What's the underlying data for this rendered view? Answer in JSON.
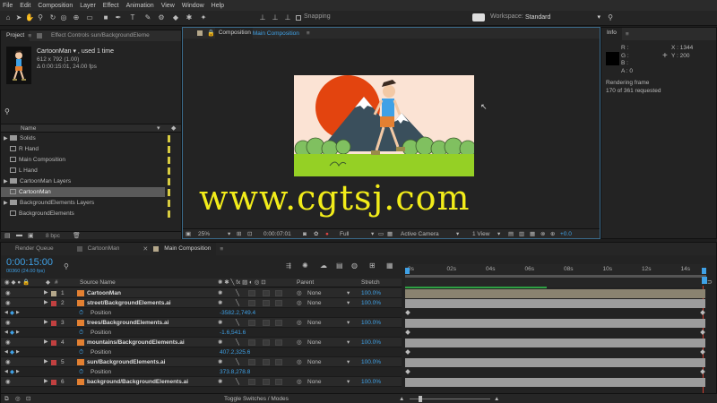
{
  "menu": [
    "File",
    "Edit",
    "Composition",
    "Layer",
    "Effect",
    "Animation",
    "View",
    "Window",
    "Help"
  ],
  "toolbar": {
    "snapping_label": "Snapping",
    "workspace_label": "Workspace:",
    "workspace_value": "Standard"
  },
  "project_panel": {
    "tab_project": "Project",
    "tab_effect_controls": "Effect Controls sun/BackgroundEleme",
    "selected_name": "CartoonMan ▾ , used 1 time",
    "selected_dims": "612 x 792 (1.00)",
    "selected_duration": "Δ 0:00:15:01, 24.00 fps",
    "column_name": "Name",
    "items": [
      {
        "label": "Solids",
        "kind": "folder"
      },
      {
        "label": "R Hand",
        "kind": "comp"
      },
      {
        "label": "Main Composition",
        "kind": "comp"
      },
      {
        "label": "L Hand",
        "kind": "comp"
      },
      {
        "label": "CartoonMan Layers",
        "kind": "folder"
      },
      {
        "label": "CartoonMan",
        "kind": "comp"
      },
      {
        "label": "BackgroundElements Layers",
        "kind": "folder"
      },
      {
        "label": "BackgroundElements",
        "kind": "comp"
      }
    ],
    "bpc": "8 bpc"
  },
  "comp_panel": {
    "tab_label": "Composition",
    "tab_comp_name": "Main Composition",
    "watermark": "www.cgtsj.com",
    "zoom": "25%",
    "timecode": "0:00:07:01",
    "resolution": "Full",
    "camera": "Active Camera",
    "view": "1 View",
    "exposure": "+0.0"
  },
  "info_panel": {
    "title": "Info",
    "r": "R :",
    "g": "G :",
    "b": "B :",
    "a": "A : 0",
    "x": "X : 1344",
    "y": "Y : 200",
    "status1": "Rendering frame",
    "status2": "170 of 361 requested"
  },
  "timeline": {
    "tabs": [
      "Render Queue",
      "CartoonMan",
      "Main Composition"
    ],
    "timecode": "0:00:15:00",
    "frame_info": "00360 (24.00 fps)",
    "col_source": "Source Name",
    "col_parent": "Parent",
    "col_stretch": "Stretch",
    "ruler": [
      "0s",
      "02s",
      "04s",
      "06s",
      "08s",
      "10s",
      "12s",
      "14s"
    ],
    "toggle_label": "Toggle Switches / Modes",
    "rows": [
      {
        "type": "layer",
        "num": "1",
        "name": "CartoonMan",
        "parent": "None",
        "stretch": "100.0%",
        "color": "#b4a78a"
      },
      {
        "type": "layer",
        "num": "2",
        "name": "street/BackgroundElements.ai",
        "parent": "None",
        "stretch": "100.0%",
        "color": "#c14040"
      },
      {
        "type": "prop",
        "name": "Position",
        "value": "-3582.2,749.4"
      },
      {
        "type": "layer",
        "num": "3",
        "name": "trees/BackgroundElements.ai",
        "parent": "None",
        "stretch": "100.0%",
        "color": "#c14040"
      },
      {
        "type": "prop",
        "name": "Position",
        "value": "-1.6,541.6"
      },
      {
        "type": "layer",
        "num": "4",
        "name": "mountains/BackgroundElements.ai",
        "parent": "None",
        "stretch": "100.0%",
        "color": "#c14040"
      },
      {
        "type": "prop",
        "name": "Position",
        "value": "407.2,325.6"
      },
      {
        "type": "layer",
        "num": "5",
        "name": "sun/BackgroundElements.ai",
        "parent": "None",
        "stretch": "100.0%",
        "color": "#c14040"
      },
      {
        "type": "prop",
        "name": "Position",
        "value": "373.8,278.8"
      },
      {
        "type": "layer",
        "num": "6",
        "name": "background/BackgroundElements.ai",
        "parent": "None",
        "stretch": "100.0%",
        "color": "#c14040"
      }
    ]
  },
  "colors": {
    "accent": "#3fa1e6",
    "sun": "#e3440f",
    "sky": "#fbe3d4",
    "grass": "#95d025",
    "mountain": "#3a4f5c",
    "tree": "#80c060",
    "watermark": "#f2ec1a"
  }
}
